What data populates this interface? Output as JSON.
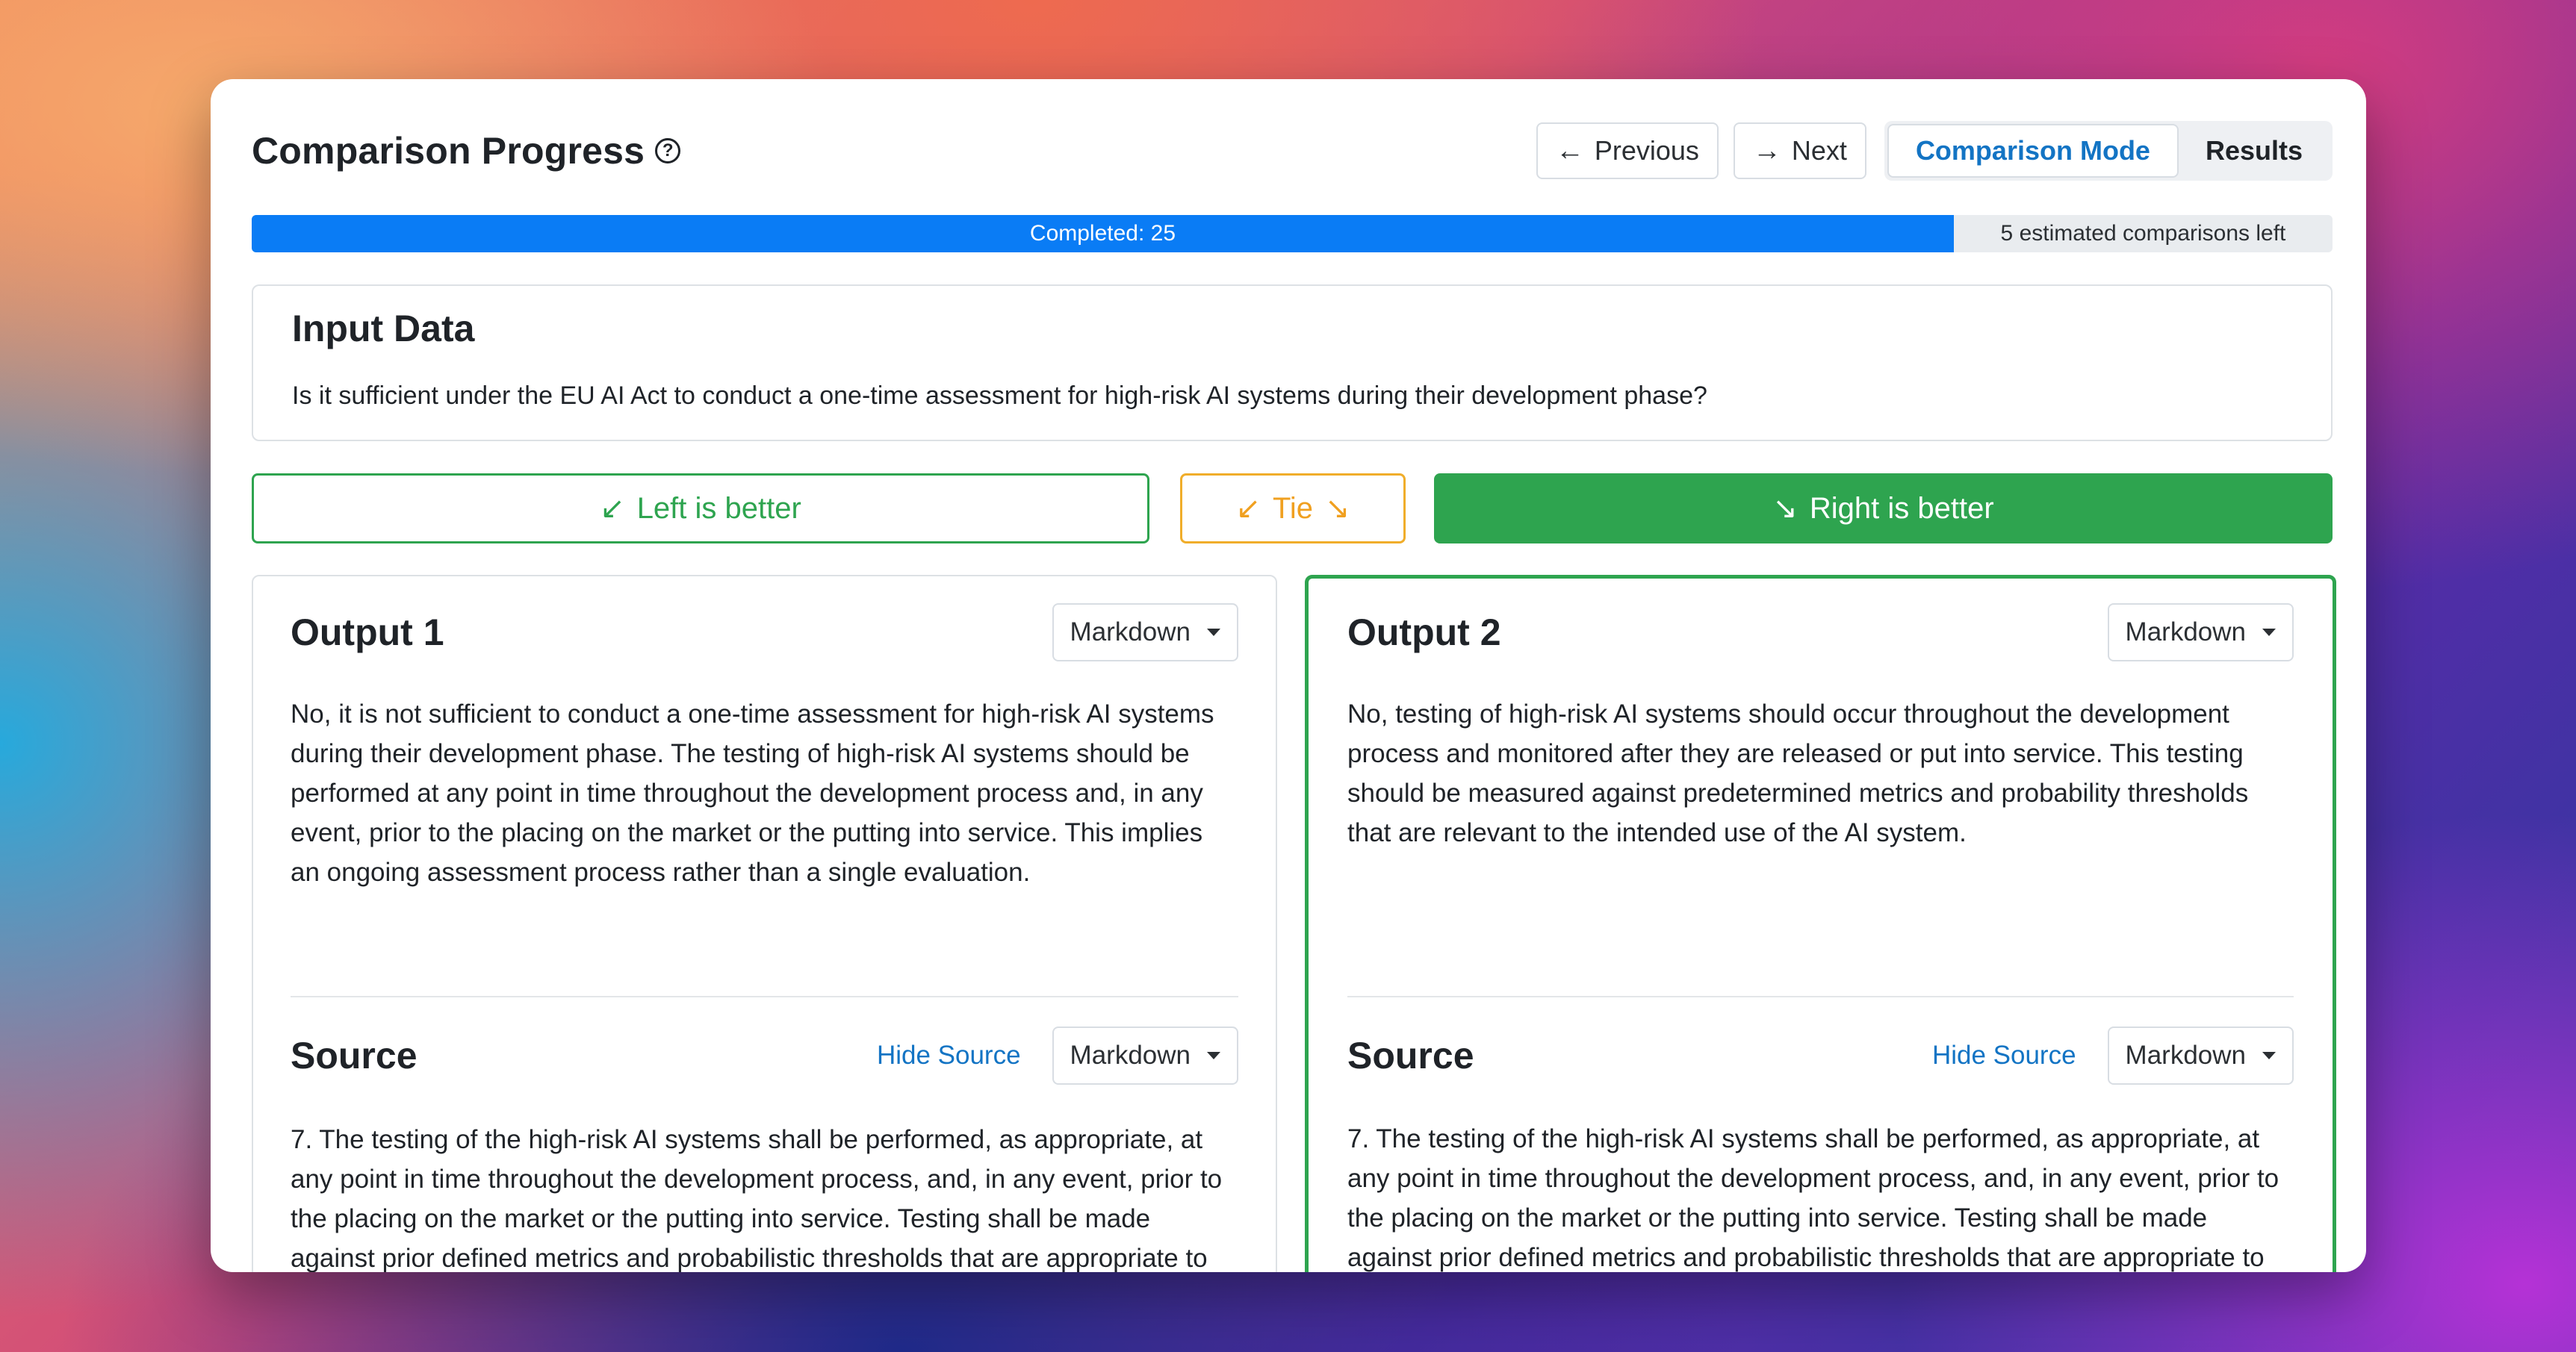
{
  "header": {
    "title": "Comparison Progress",
    "help_icon": "question-circle-icon",
    "previous_label": "Previous",
    "next_label": "Next",
    "mode_tabs": [
      {
        "label": "Comparison Mode",
        "active": true
      },
      {
        "label": "Results",
        "active": false
      }
    ]
  },
  "progress": {
    "completed_label": "Completed: 25",
    "remaining_label": "5 estimated comparisons left",
    "completed": 25,
    "remaining": 5,
    "fill_color": "#0a7cf5"
  },
  "input": {
    "title": "Input Data",
    "text": "Is it sufficient under the EU AI Act to conduct a one-time assessment for high-risk AI systems during their development phase?"
  },
  "vote": {
    "left_label": "Left is better",
    "tie_label": "Tie",
    "right_label": "Right is better",
    "left_icon": "arrow-down-left-icon",
    "right_icon": "arrow-down-right-icon",
    "selected": "right",
    "green": "#2ea44f",
    "amber": "#f0ad2a"
  },
  "outputs": [
    {
      "title": "Output 1",
      "format": "Markdown",
      "text": "No, it is not sufficient to conduct a one-time assessment for high-risk AI systems during their development phase. The testing of high-risk AI systems should be performed at any point in time throughout the development process and, in any event, prior to the placing on the market or the putting into service. This implies an ongoing assessment process rather than a single evaluation.",
      "source_title": "Source",
      "hide_source_label": "Hide Source",
      "source_format": "Markdown",
      "source_text": "7. The testing of the high-risk AI systems shall be performed, as appropriate, at any point in time throughout the development process, and, in any event, prior to the placing on the market or the putting into service. Testing shall be made against prior defined metrics and probabilistic thresholds that are appropriate to the intended purpose of the high-risk AI system."
    },
    {
      "title": "Output 2",
      "format": "Markdown",
      "text": "No, testing of high-risk AI systems should occur throughout the development process and monitored after they are released or put into service. This testing should be measured against predetermined metrics and probability thresholds that are relevant to the intended use of the AI system.",
      "source_title": "Source",
      "hide_source_label": "Hide Source",
      "source_format": "Markdown",
      "source_text": "7. The testing of the high-risk AI systems shall be performed, as appropriate, at any point in time throughout the development process, and, in any event, prior to the placing on the market or the putting into service. Testing shall be made against prior defined metrics and probabilistic thresholds that are appropriate to the intended purpose of the high-risk AI system."
    }
  ]
}
